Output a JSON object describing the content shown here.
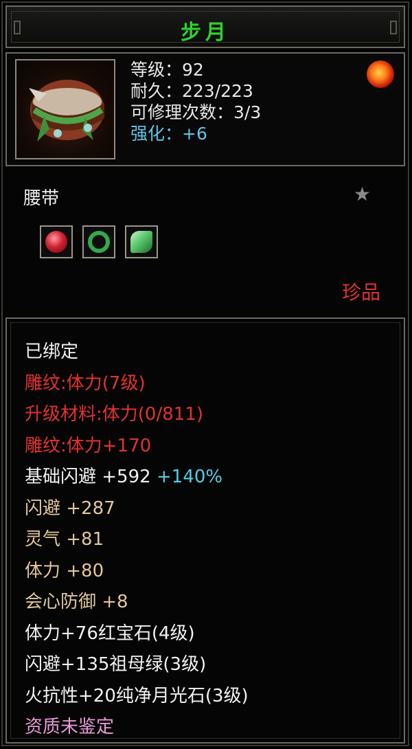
{
  "title": "步月",
  "header": {
    "level": "等级：92",
    "durability": "耐久：223/223",
    "repair_count": "可修理次数：3/3",
    "strengthen": "强化：+6"
  },
  "item_type": "腰带",
  "rarity": "珍品",
  "gems": [
    {
      "icon": "red-gem-icon",
      "color": "#c81e2a"
    },
    {
      "icon": "green-ring-gem-icon",
      "color": "#2fa34a"
    },
    {
      "icon": "green-crystal-gem-icon",
      "color": "#5ac86e"
    }
  ],
  "attributes": {
    "bound": "已绑定",
    "engrave_1": "雕纹:体力(7级)",
    "upgrade_material": "升级材料:体力(0/811)",
    "engrave_2": "雕纹:体力+170",
    "base_dodge": "基础闪避  +592",
    "base_dodge_bonus": "+140%",
    "dodge": "闪避  +287",
    "spirit": "灵气  +81",
    "stamina": "体力  +80",
    "crit_defense": "会心防御  +8",
    "gem_1": "体力+76红宝石(4级)",
    "gem_2": "闪避+135祖母绿(3级)",
    "gem_3": "火抗性+20纯净月光石(3级)",
    "quality": "资质未鉴定"
  },
  "colors": {
    "title": "#2fd02f",
    "strengthen": "#5fc3e4",
    "red": "#e3322f",
    "tan": "#e2c79a",
    "cyan": "#4fd0e6",
    "pink": "#e79ad6"
  }
}
